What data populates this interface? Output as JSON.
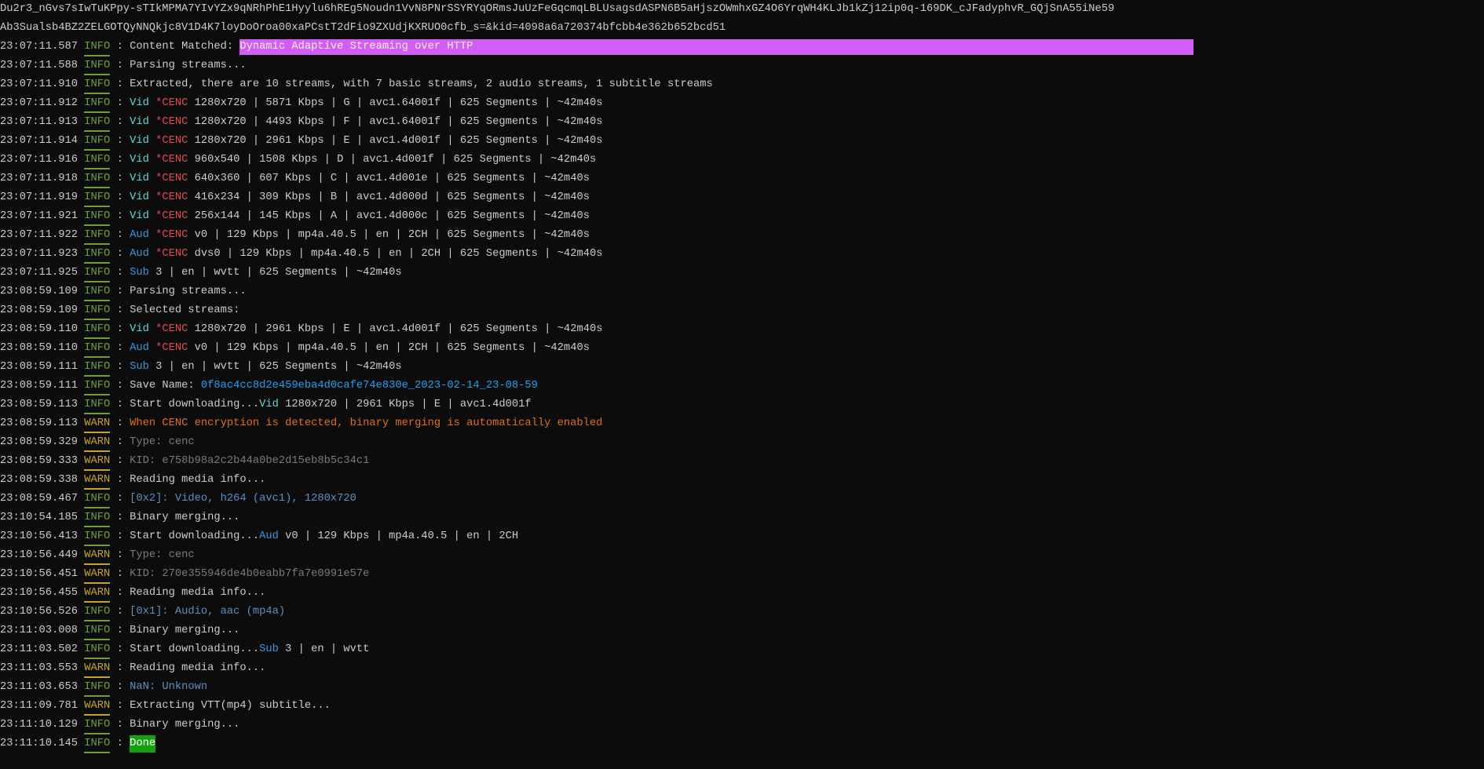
{
  "header_lines": [
    "Du2r3_nGvs7sIwTuKPpy-sTIkMPMA7YIvYZx9qNRhPhE1Hyylu6hREg5Noudn1VvN8PNrSSYRYqORmsJuUzFeGqcmqLBLUsagsdASPN6B5aHjszOWmhxGZ4O6YrqWH4KLJb1kZj12ip0q-169DK_cJFadyphvR_GQjSnA55iNe59",
    "Ab3Sualsb4BZ2ZELGOTQyNNQkjc8V1D4K7loyDoOroa00xaPCstT2dFio9ZXUdjKXRUO0cfb_s=&kid=4098a6a720374bfcbb4e362b652bcd51"
  ],
  "colors": {
    "background": "#0c0c0c",
    "info": "#6a9f2a",
    "warn": "#c8a31e",
    "highlight": "#d35df5",
    "done": "#13a10e"
  },
  "log": [
    {
      "time": "23:07:11.587",
      "level": "INFO",
      "parts": [
        {
          "t": "Content Matched: ",
          "c": "n"
        },
        {
          "t": "Dynamic Adaptive Streaming over HTTP",
          "c": "mag"
        }
      ]
    },
    {
      "time": "23:07:11.588",
      "level": "INFO",
      "parts": [
        {
          "t": "Parsing streams...",
          "c": "n"
        }
      ]
    },
    {
      "time": "23:07:11.910",
      "level": "INFO",
      "parts": [
        {
          "t": "Extracted, there are 10 streams, with 7 basic streams, 2 audio streams, 1 subtitle streams",
          "c": "n"
        }
      ]
    },
    {
      "time": "23:07:11.912",
      "level": "INFO",
      "parts": [
        {
          "t": "Vid ",
          "c": "vid"
        },
        {
          "t": "*CENC",
          "c": "cenc"
        },
        {
          "t": " 1280x720 | 5871 Kbps | G | avc1.64001f | 625 Segments | ~42m40s",
          "c": "n"
        }
      ]
    },
    {
      "time": "23:07:11.913",
      "level": "INFO",
      "parts": [
        {
          "t": "Vid ",
          "c": "vid"
        },
        {
          "t": "*CENC",
          "c": "cenc"
        },
        {
          "t": " 1280x720 | 4493 Kbps | F | avc1.64001f | 625 Segments | ~42m40s",
          "c": "n"
        }
      ]
    },
    {
      "time": "23:07:11.914",
      "level": "INFO",
      "parts": [
        {
          "t": "Vid ",
          "c": "vid"
        },
        {
          "t": "*CENC",
          "c": "cenc"
        },
        {
          "t": " 1280x720 | 2961 Kbps | E | avc1.4d001f | 625 Segments | ~42m40s",
          "c": "n"
        }
      ]
    },
    {
      "time": "23:07:11.916",
      "level": "INFO",
      "parts": [
        {
          "t": "Vid ",
          "c": "vid"
        },
        {
          "t": "*CENC",
          "c": "cenc"
        },
        {
          "t": " 960x540 | 1508 Kbps | D | avc1.4d001f | 625 Segments | ~42m40s",
          "c": "n"
        }
      ]
    },
    {
      "time": "23:07:11.918",
      "level": "INFO",
      "parts": [
        {
          "t": "Vid ",
          "c": "vid"
        },
        {
          "t": "*CENC",
          "c": "cenc"
        },
        {
          "t": " 640x360 | 607 Kbps | C | avc1.4d001e | 625 Segments | ~42m40s",
          "c": "n"
        }
      ]
    },
    {
      "time": "23:07:11.919",
      "level": "INFO",
      "parts": [
        {
          "t": "Vid ",
          "c": "vid"
        },
        {
          "t": "*CENC",
          "c": "cenc"
        },
        {
          "t": " 416x234 | 309 Kbps | B | avc1.4d000d | 625 Segments | ~42m40s",
          "c": "n"
        }
      ]
    },
    {
      "time": "23:07:11.921",
      "level": "INFO",
      "parts": [
        {
          "t": "Vid ",
          "c": "vid"
        },
        {
          "t": "*CENC",
          "c": "cenc"
        },
        {
          "t": " 256x144 | 145 Kbps | A | avc1.4d000c | 625 Segments | ~42m40s",
          "c": "n"
        }
      ]
    },
    {
      "time": "23:07:11.922",
      "level": "INFO",
      "parts": [
        {
          "t": "Aud ",
          "c": "aud"
        },
        {
          "t": "*CENC",
          "c": "cenc"
        },
        {
          "t": " v0 | 129 Kbps | mp4a.40.5 | en | 2CH | 625 Segments | ~42m40s",
          "c": "n"
        }
      ]
    },
    {
      "time": "23:07:11.923",
      "level": "INFO",
      "parts": [
        {
          "t": "Aud ",
          "c": "aud"
        },
        {
          "t": "*CENC",
          "c": "cenc"
        },
        {
          "t": " dvs0 | 129 Kbps | mp4a.40.5 | en | 2CH | 625 Segments | ~42m40s",
          "c": "n"
        }
      ]
    },
    {
      "time": "23:07:11.925",
      "level": "INFO",
      "parts": [
        {
          "t": "Sub",
          "c": "aud"
        },
        {
          "t": " 3 | en | wvtt | 625 Segments | ~42m40s",
          "c": "n"
        }
      ]
    },
    {
      "time": "23:08:59.109",
      "level": "INFO",
      "parts": [
        {
          "t": "Parsing streams...",
          "c": "n"
        }
      ]
    },
    {
      "time": "23:08:59.109",
      "level": "INFO",
      "parts": [
        {
          "t": "Selected streams:",
          "c": "n"
        }
      ]
    },
    {
      "time": "23:08:59.110",
      "level": "INFO",
      "parts": [
        {
          "t": "Vid ",
          "c": "vid"
        },
        {
          "t": "*CENC",
          "c": "cenc"
        },
        {
          "t": " 1280x720 | 2961 Kbps | E | avc1.4d001f | 625 Segments | ~42m40s",
          "c": "n"
        }
      ]
    },
    {
      "time": "23:08:59.110",
      "level": "INFO",
      "parts": [
        {
          "t": "Aud ",
          "c": "aud"
        },
        {
          "t": "*CENC",
          "c": "cenc"
        },
        {
          "t": " v0 | 129 Kbps | mp4a.40.5 | en | 2CH | 625 Segments | ~42m40s",
          "c": "n"
        }
      ]
    },
    {
      "time": "23:08:59.111",
      "level": "INFO",
      "parts": [
        {
          "t": "Sub",
          "c": "aud"
        },
        {
          "t": " 3 | en | wvtt | 625 Segments | ~42m40s",
          "c": "n"
        }
      ]
    },
    {
      "time": "23:08:59.111",
      "level": "INFO",
      "parts": [
        {
          "t": "Save Name: ",
          "c": "n"
        },
        {
          "t": "0f8ac4cc8d2e459eba4d0cafe74e830e_2023-02-14_23-08-59",
          "c": "save"
        }
      ]
    },
    {
      "time": "23:08:59.113",
      "level": "INFO",
      "parts": [
        {
          "t": "Start downloading...",
          "c": "n"
        },
        {
          "t": "Vid",
          "c": "vid"
        },
        {
          "t": " 1280x720 | 2961 Kbps | E | avc1.4d001f",
          "c": "n"
        }
      ]
    },
    {
      "time": "23:08:59.113",
      "level": "WARN",
      "parts": [
        {
          "t": "When CENC encryption is detected, binary merging is automatically enabled",
          "c": "orange"
        }
      ]
    },
    {
      "time": "23:08:59.329",
      "level": "WARN",
      "parts": [
        {
          "t": "Type: cenc",
          "c": "gray"
        }
      ]
    },
    {
      "time": "23:08:59.333",
      "level": "WARN",
      "parts": [
        {
          "t": "KID: e758b98a2c2b44a0be2d15eb8b5c34c1",
          "c": "gray"
        }
      ]
    },
    {
      "time": "23:08:59.338",
      "level": "WARN",
      "parts": [
        {
          "t": "Reading media info...",
          "c": "n"
        }
      ]
    },
    {
      "time": "23:08:59.467",
      "level": "INFO",
      "parts": [
        {
          "t": "[0x2]: Video, h264 (avc1), 1280x720",
          "c": "steel"
        }
      ]
    },
    {
      "time": "23:10:54.185",
      "level": "INFO",
      "parts": [
        {
          "t": "Binary merging...",
          "c": "n"
        }
      ]
    },
    {
      "time": "23:10:56.413",
      "level": "INFO",
      "parts": [
        {
          "t": "Start downloading...",
          "c": "n"
        },
        {
          "t": "Aud",
          "c": "aud"
        },
        {
          "t": " v0 | 129 Kbps | mp4a.40.5 | en | 2CH",
          "c": "n"
        }
      ]
    },
    {
      "time": "23:10:56.449",
      "level": "WARN",
      "parts": [
        {
          "t": "Type: cenc",
          "c": "gray"
        }
      ]
    },
    {
      "time": "23:10:56.451",
      "level": "WARN",
      "parts": [
        {
          "t": "KID: 270e355946de4b0eabb7fa7e0991e57e",
          "c": "gray"
        }
      ]
    },
    {
      "time": "23:10:56.455",
      "level": "WARN",
      "parts": [
        {
          "t": "Reading media info...",
          "c": "n"
        }
      ]
    },
    {
      "time": "23:10:56.526",
      "level": "INFO",
      "parts": [
        {
          "t": "[0x1]: Audio, aac (mp4a)",
          "c": "steel"
        }
      ]
    },
    {
      "time": "23:11:03.008",
      "level": "INFO",
      "parts": [
        {
          "t": "Binary merging...",
          "c": "n"
        }
      ]
    },
    {
      "time": "23:11:03.502",
      "level": "INFO",
      "parts": [
        {
          "t": "Start downloading...",
          "c": "n"
        },
        {
          "t": "Sub",
          "c": "aud"
        },
        {
          "t": " 3 | en | wvtt",
          "c": "n"
        }
      ]
    },
    {
      "time": "23:11:03.553",
      "level": "WARN",
      "parts": [
        {
          "t": "Reading media info...",
          "c": "n"
        }
      ]
    },
    {
      "time": "23:11:03.653",
      "level": "INFO",
      "parts": [
        {
          "t": "NaN: Unknown",
          "c": "steel"
        }
      ]
    },
    {
      "time": "23:11:09.781",
      "level": "WARN",
      "parts": [
        {
          "t": "Extracting VTT(mp4) subtitle...",
          "c": "n"
        }
      ]
    },
    {
      "time": "23:11:10.129",
      "level": "INFO",
      "parts": [
        {
          "t": "Binary merging...",
          "c": "n"
        }
      ]
    },
    {
      "time": "23:11:10.145",
      "level": "INFO",
      "parts": [
        {
          "t": "Done",
          "c": "done"
        }
      ]
    }
  ],
  "separator": " : "
}
